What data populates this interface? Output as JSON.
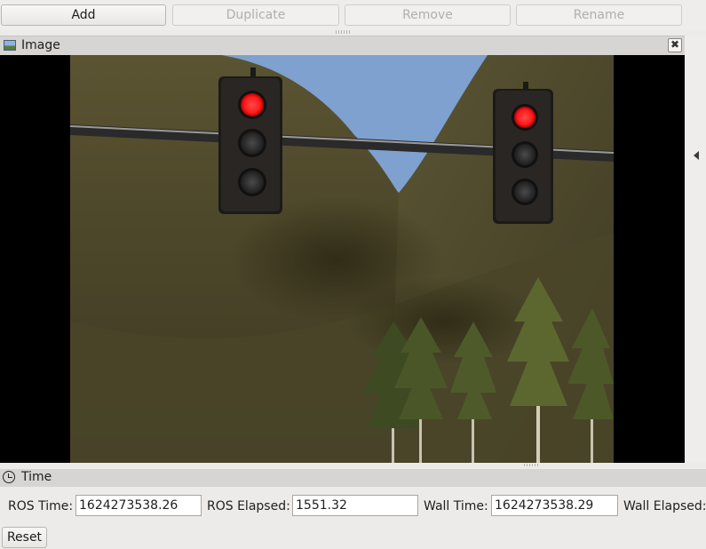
{
  "toolbar": {
    "add_label": "Add",
    "duplicate_label": "Duplicate",
    "remove_label": "Remove",
    "rename_label": "Rename"
  },
  "image_panel": {
    "title": "Image",
    "close_glyph": "✖",
    "icon": "image-icon",
    "scene": {
      "sky_color": "#7ea1cf",
      "hill_color": "#4f4a2c",
      "traffic_lights": [
        {
          "state": "red",
          "red_color": "#ff2020"
        },
        {
          "state": "red",
          "red_color": "#ff2020"
        }
      ]
    }
  },
  "time_panel": {
    "title": "Time",
    "icon": "clock-icon",
    "ros_time_label": "ROS Time:",
    "ros_time_value": "1624273538.26",
    "ros_elapsed_label": "ROS Elapsed:",
    "ros_elapsed_value": "1551.32",
    "wall_time_label": "Wall Time:",
    "wall_time_value": "1624273538.29",
    "wall_elapsed_label": "Wall Elapsed:",
    "reset_label": "Reset"
  }
}
